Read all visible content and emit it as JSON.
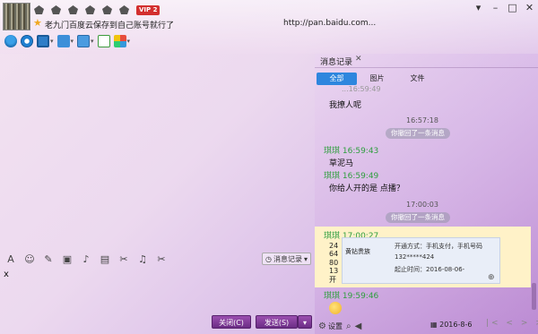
{
  "header": {
    "vip_label": "VIP 2",
    "signature": "老九门百度云保存到自己账号就行了",
    "url": "http://pan.baidu.com...",
    "window_controls": [
      "▾",
      "–",
      "□",
      "✕"
    ]
  },
  "input": {
    "history_label": "消息记录",
    "text": "x",
    "close_label": "关闭(C)",
    "send_label": "发送(S)"
  },
  "panel": {
    "tab_title": "消息记录",
    "tab_close": "✕",
    "filters": [
      "全部",
      "图片",
      "文件"
    ],
    "messages": {
      "m0_partial": "...16:59:49",
      "m1_body": "我撩人呢",
      "m2_time": "16:57:18",
      "m2_pill": "你撤回了一条消息",
      "m3_sender": "琪琪 16:59:43",
      "m3_body": "草泥马",
      "m4_sender": "琪琪 16:59:49",
      "m4_body": "你给人开的是 点播？",
      "m5_time": "17:00:03",
      "m5_pill": "你撤回了一条消息",
      "m6_sender": "琪琪 17:00:27",
      "frag1": "24",
      "frag2": "64",
      "frag3": "80",
      "frag4": "13",
      "frag5": "开",
      "m7_sender": "琪琪 19:59:46"
    },
    "card": {
      "title": "黄钻贵族",
      "line1": "开通方式：手机支付，手机号码",
      "line2": "132*****424",
      "line3": "起止时间：2016-08-06-"
    },
    "settings_label": "设置",
    "date": "2016-8-6",
    "nav": "|< < > >|"
  },
  "colors": {
    "accent_blue": "#2e86de",
    "sender_green": "#2e9e3e",
    "button_purple": "#7a3592",
    "highlight_yellow": "#fff2c8"
  }
}
